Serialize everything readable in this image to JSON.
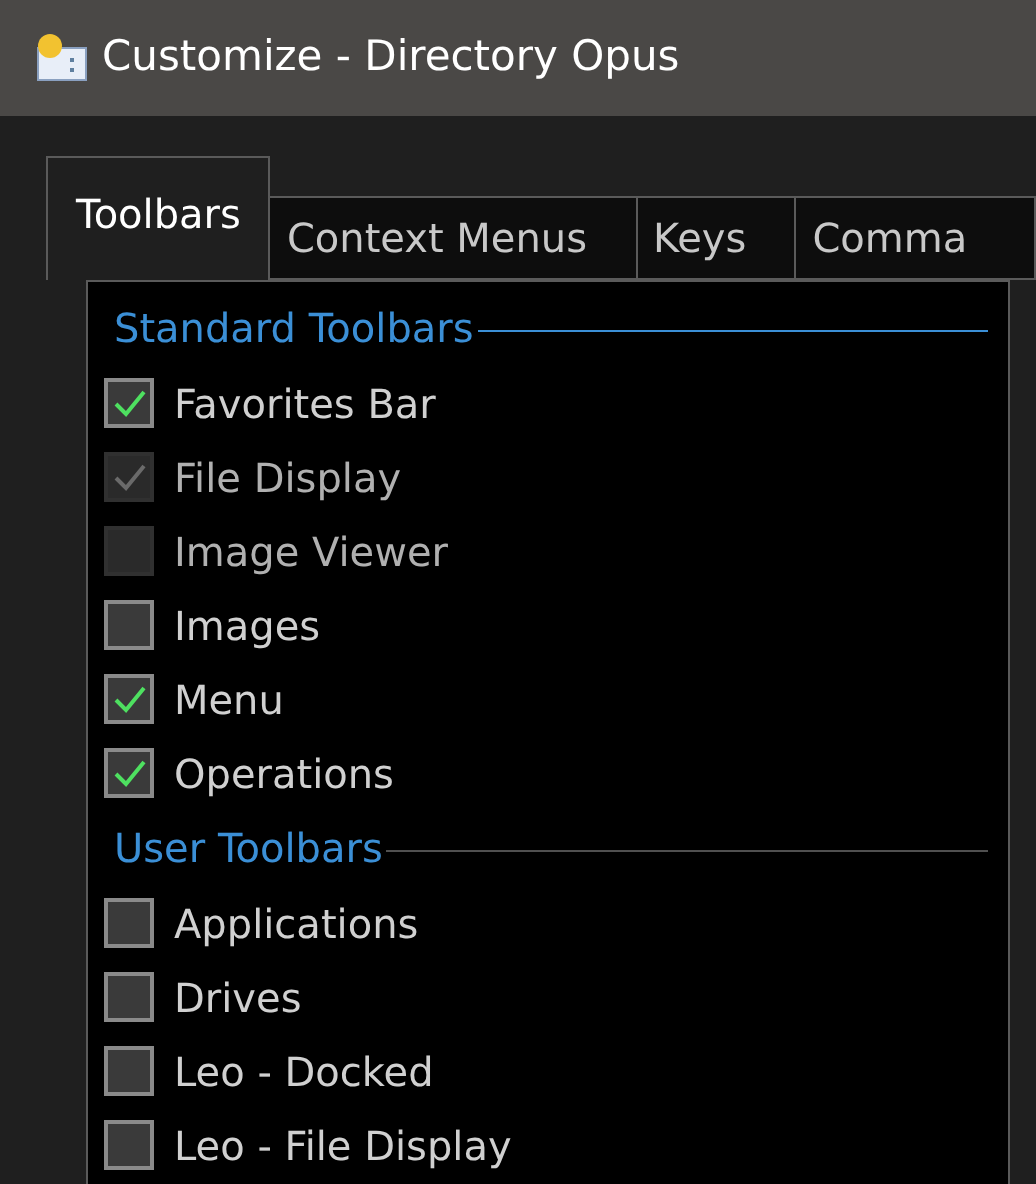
{
  "window": {
    "title": "Customize - Directory Opus"
  },
  "tabs": [
    {
      "label": "Toolbars",
      "selected": true
    },
    {
      "label": "Context Menus",
      "selected": false
    },
    {
      "label": "Keys",
      "selected": false
    },
    {
      "label": "Comma",
      "selected": false
    }
  ],
  "groups": [
    {
      "heading": "Standard Toolbars",
      "items": [
        {
          "label": "Favorites Bar",
          "checked": true,
          "disabled": false
        },
        {
          "label": "File Display",
          "checked": true,
          "disabled": true
        },
        {
          "label": "Image Viewer",
          "checked": false,
          "disabled": true
        },
        {
          "label": "Images",
          "checked": false,
          "disabled": false
        },
        {
          "label": "Menu",
          "checked": true,
          "disabled": false
        },
        {
          "label": "Operations",
          "checked": true,
          "disabled": false
        }
      ]
    },
    {
      "heading": "User Toolbars",
      "items": [
        {
          "label": "Applications",
          "checked": false,
          "disabled": false
        },
        {
          "label": "Drives",
          "checked": false,
          "disabled": false
        },
        {
          "label": "Leo - Docked",
          "checked": false,
          "disabled": false
        },
        {
          "label": "Leo - File Display",
          "checked": false,
          "disabled": false
        }
      ]
    }
  ]
}
